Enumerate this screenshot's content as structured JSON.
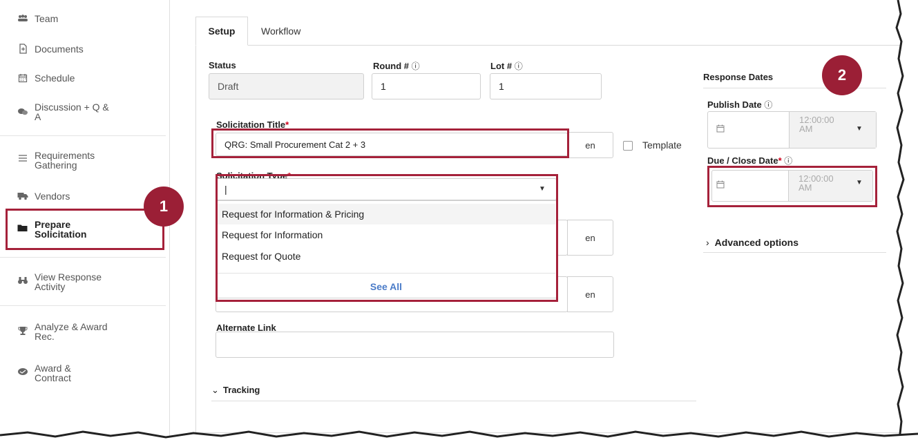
{
  "sidebar": {
    "items": [
      {
        "label_lines": [
          "Team"
        ],
        "icon": "team-icon"
      },
      {
        "label_lines": [
          "Documents"
        ],
        "icon": "documents-icon"
      },
      {
        "label_lines": [
          "Schedule"
        ],
        "icon": "calendar-icon"
      },
      {
        "label_lines": [
          "Discussion + Q &",
          "A"
        ],
        "icon": "discussion-icon"
      },
      {
        "label_lines": [
          "Requirements",
          "Gathering"
        ],
        "icon": "list-icon"
      },
      {
        "label_lines": [
          "Vendors"
        ],
        "icon": "truck-icon"
      },
      {
        "label_lines": [
          "Prepare",
          "Solicitation"
        ],
        "icon": "folder-icon",
        "active": true
      },
      {
        "label_lines": [
          "View Response",
          "Activity"
        ],
        "icon": "binoculars-icon"
      },
      {
        "label_lines": [
          "Analyze & Award",
          "Rec."
        ],
        "icon": "trophy-icon"
      },
      {
        "label_lines": [
          "Award &",
          "Contract"
        ],
        "icon": "handshake-icon"
      }
    ]
  },
  "callouts": {
    "one": "1",
    "two": "2"
  },
  "tabs": {
    "setup": "Setup",
    "workflow": "Workflow"
  },
  "form": {
    "status_label": "Status",
    "status_value": "Draft",
    "round_label": "Round #",
    "round_value": "1",
    "lot_label": "Lot #",
    "lot_value": "1",
    "info_glyph": "ⓘ",
    "title_label": "Solicitation Title",
    "title_value": "QRG: Small Procurement Cat 2 + 3",
    "lang": "en",
    "template_label": "Template",
    "type_label": "Solicitation Type",
    "type_value": "|",
    "required_mark": "*",
    "type_options": [
      "Request for Information & Pricing",
      "Request for Information",
      "Request for Quote"
    ],
    "see_all": "See All",
    "alternate_link_label": "Alternate Link",
    "tracking_label": "Tracking"
  },
  "response_dates": {
    "heading": "Response Dates",
    "publish_label": "Publish Date",
    "due_label": "Due / Close Date",
    "time_lines": [
      "12:00:00",
      "AM"
    ],
    "advanced": "Advanced options"
  },
  "colors": {
    "accent": "#a5213a",
    "callout": "#9b1f36",
    "link": "#4a7bc8",
    "required": "#d0021b"
  }
}
